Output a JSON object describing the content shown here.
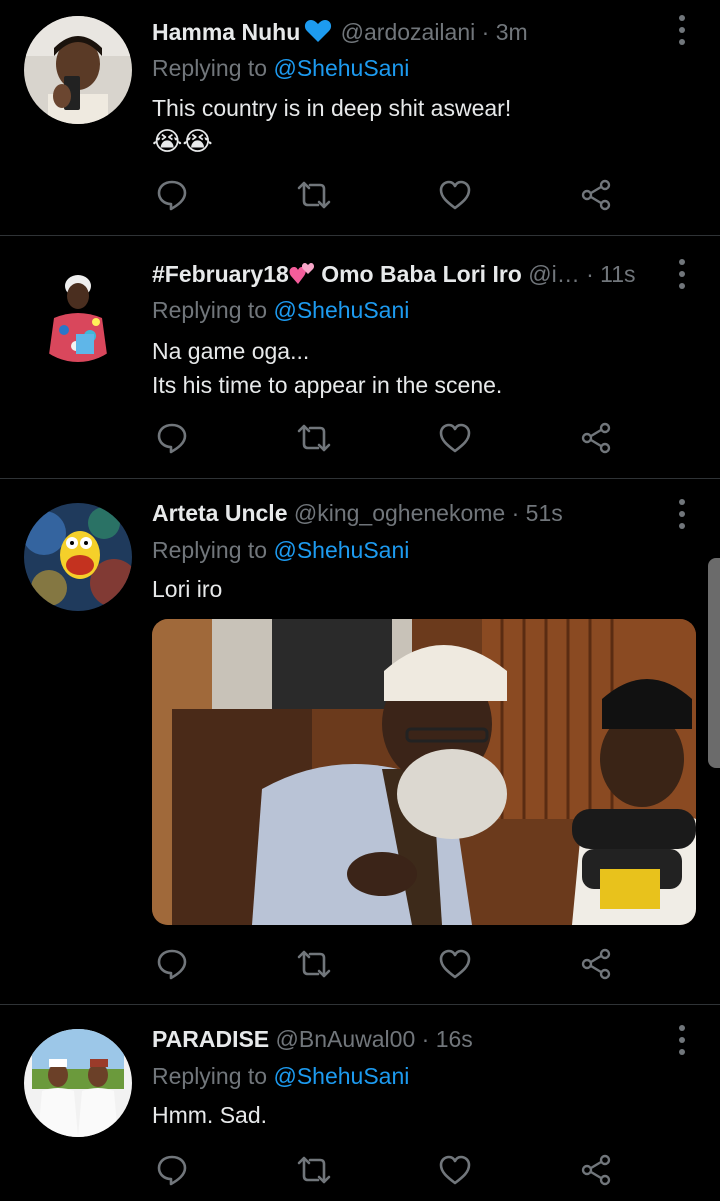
{
  "colors": {
    "background": "#000000",
    "text": "#e7e9ea",
    "muted": "#71767b",
    "accent": "#1d9bf0",
    "verified_heart": "#1d9bf0",
    "divider": "#2f3336"
  },
  "icons": {
    "reply": "comment-bubble-icon",
    "retweet": "retweet-icon",
    "like": "heart-icon",
    "share": "share-icon",
    "more": "vertical-dots-icon"
  },
  "tweets": [
    {
      "name": "Hamma Nuhu",
      "badge": "blue-heart-icon",
      "handle": "@ardozailani",
      "separator": "·",
      "time": "3m",
      "replying_prefix": "Replying to ",
      "replying_to": "@ShehuSani",
      "text": "This country is in deep shit aswear!",
      "emojis": "😭😭"
    },
    {
      "name": "#February18",
      "badge": "heart-emoji",
      "name_suffix": "Omo Baba Lori Iro",
      "handle": "@i…",
      "separator": "·",
      "time": "11s",
      "replying_prefix": "Replying to ",
      "replying_to": "@ShehuSani",
      "text": "Na game oga...\nIts his time to appear in the scene."
    },
    {
      "name": "Arteta Uncle",
      "handle": "@king_oghenekome",
      "separator": "·",
      "time": "51s",
      "replying_prefix": "Replying to ",
      "replying_to": "@ShehuSani",
      "text": "Lori iro",
      "media": "photo"
    },
    {
      "name": "PARADISE",
      "handle": "@BnAuwal00",
      "separator": "·",
      "time": "16s",
      "replying_prefix": "Replying to ",
      "replying_to": "@ShehuSani",
      "text": "Hmm. Sad."
    }
  ]
}
